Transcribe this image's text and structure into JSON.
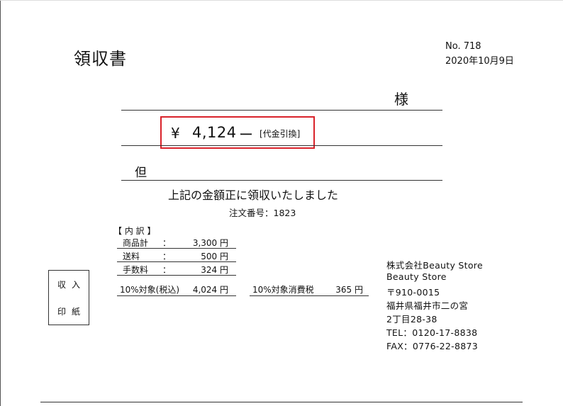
{
  "receipt": {
    "title": "領収書",
    "number": "No. 718",
    "date": "2020年10月9日",
    "recipient_suffix": "様",
    "currency_symbol": "¥",
    "amount": "4,124",
    "amount_dash": "ー",
    "payment_method": "[代金引換]",
    "proviso_label": "但",
    "received_text": "上記の金額正に領収いたしました",
    "order_number": "注文番号：1823"
  },
  "breakdown": {
    "title": "【 内 訳 】",
    "rows": [
      {
        "label": "商品計",
        "colon": "：",
        "value": "3,300 円"
      },
      {
        "label": "送料",
        "colon": "：",
        "value": "500 円"
      },
      {
        "label": "手数料",
        "colon": "：",
        "value": "324 円"
      }
    ],
    "tax_target_label": "10%対象(税込)",
    "tax_target_value": "4,024 円",
    "consumption_tax_label": "10%対象消費税",
    "consumption_tax_value": "365 円"
  },
  "stamp": {
    "line1": "収入",
    "line2": "印紙"
  },
  "company": {
    "name": "株式会社Beauty Store",
    "store": "Beauty Store",
    "postal": "〒910-0015",
    "address1": "福井県福井市二の宮",
    "address2": "2丁目28-38",
    "tel": "TEL：0120-17-8838",
    "fax": "FAX：0776-22-8873"
  }
}
